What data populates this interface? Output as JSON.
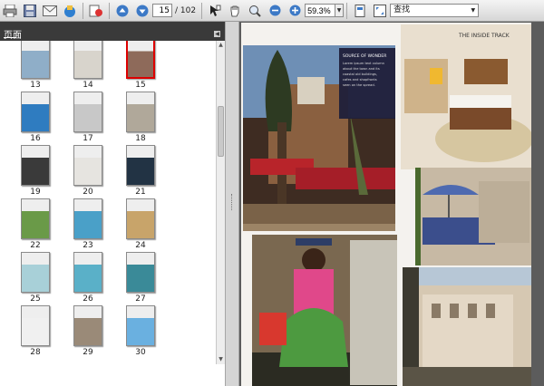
{
  "toolbar": {
    "current_page": "15",
    "total_pages": "/ 102",
    "zoom": "59.3%",
    "find_text": "查找",
    "icons": [
      "print-icon",
      "save-icon",
      "email-icon",
      "upload-icon",
      "sign-icon",
      "prev-page-icon",
      "next-page-icon",
      "select-text-icon",
      "hand-icon",
      "zoom-tool-icon",
      "zoom-out-icon",
      "zoom-in-icon",
      "fit-page-icon",
      "full-screen-icon"
    ]
  },
  "panel": {
    "title": "页面",
    "thumbnail_labels": [
      "13",
      "14",
      "15",
      "16",
      "17",
      "18",
      "19",
      "20",
      "21",
      "22",
      "23",
      "24",
      "25",
      "26",
      "27",
      "28",
      "29",
      "30"
    ],
    "selected_label": "15"
  },
  "colors": {
    "selection": "#dd0000",
    "panel_dark": "#3a3a3a",
    "doc_bg": "#5c5c5c"
  },
  "magazine": {
    "header": "THE INSIDE TRACK",
    "caption_title": "SOURCE OF WONDER",
    "caption_lines": [
      "Lorem ipsum text column",
      "about the town and its",
      "coastal old buildings,",
      "cafes and shopfronts",
      "seen on the spread."
    ]
  }
}
